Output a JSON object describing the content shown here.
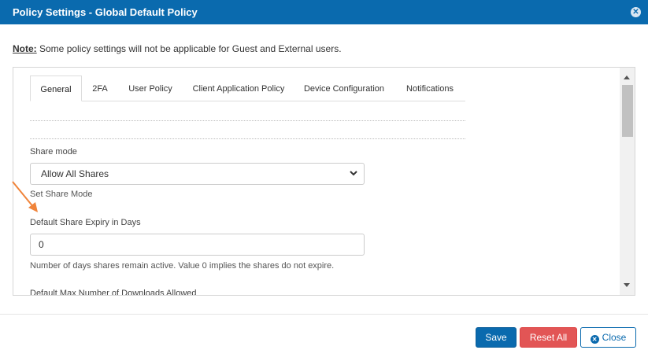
{
  "dialog": {
    "title": "Policy Settings - Global Default Policy",
    "close_glyph": "✕"
  },
  "note": {
    "label": "Note:",
    "text": " Some policy settings will not be applicable for Guest and External users."
  },
  "tabs": [
    {
      "label": "General",
      "active": true
    },
    {
      "label": "2FA"
    },
    {
      "label": "User Policy"
    },
    {
      "label": "Client Application Policy"
    },
    {
      "label": "Device Configuration"
    },
    {
      "label": "Notifications"
    }
  ],
  "share_mode": {
    "label": "Share mode",
    "value": "Allow All Shares",
    "help": "Set Share Mode"
  },
  "expiry": {
    "label": "Default Share Expiry in Days",
    "value": "0",
    "help": "Number of days shares remain active. Value 0 implies the shares do not expire."
  },
  "max_downloads": {
    "label": "Default Max Number of Downloads Allowed"
  },
  "footer": {
    "save": "Save",
    "reset": "Reset All",
    "close": "Close"
  },
  "colors": {
    "primary": "#0a6aae",
    "danger": "#e25555",
    "annotation_arrow": "#f0843a"
  }
}
